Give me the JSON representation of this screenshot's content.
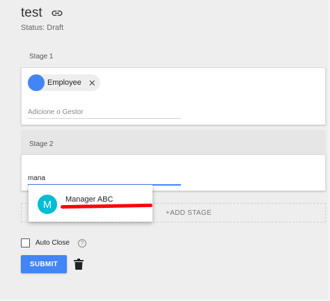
{
  "header": {
    "title": "test",
    "link_icon": "link-icon",
    "status": "Status: Draft"
  },
  "stages": [
    {
      "label": "Stage 1",
      "chip": {
        "label": "Employee",
        "avatar_color": "#4285f4",
        "remove_icon": "close-icon",
        "remove_glyph": "✕"
      },
      "input": {
        "placeholder": "Adicione o Gestor",
        "value": ""
      }
    },
    {
      "label": "Stage 2",
      "input": {
        "placeholder": "",
        "value": "mana"
      }
    }
  ],
  "dropdown": {
    "options": [
      {
        "avatar_letter": "M",
        "avatar_color": "#00bcd4",
        "name": "Manager ABC"
      }
    ]
  },
  "add_stage": {
    "label": "+ADD STAGE"
  },
  "auto_close": {
    "label": "Auto Close",
    "checked": false,
    "help_icon": "help-circle-icon",
    "help_glyph": "?"
  },
  "actions": {
    "submit_label": "SUBMIT",
    "delete_icon": "trash-icon"
  },
  "colors": {
    "primary": "#4285f4",
    "avatar_teal": "#00bcd4",
    "redaction": "#ff0000"
  }
}
